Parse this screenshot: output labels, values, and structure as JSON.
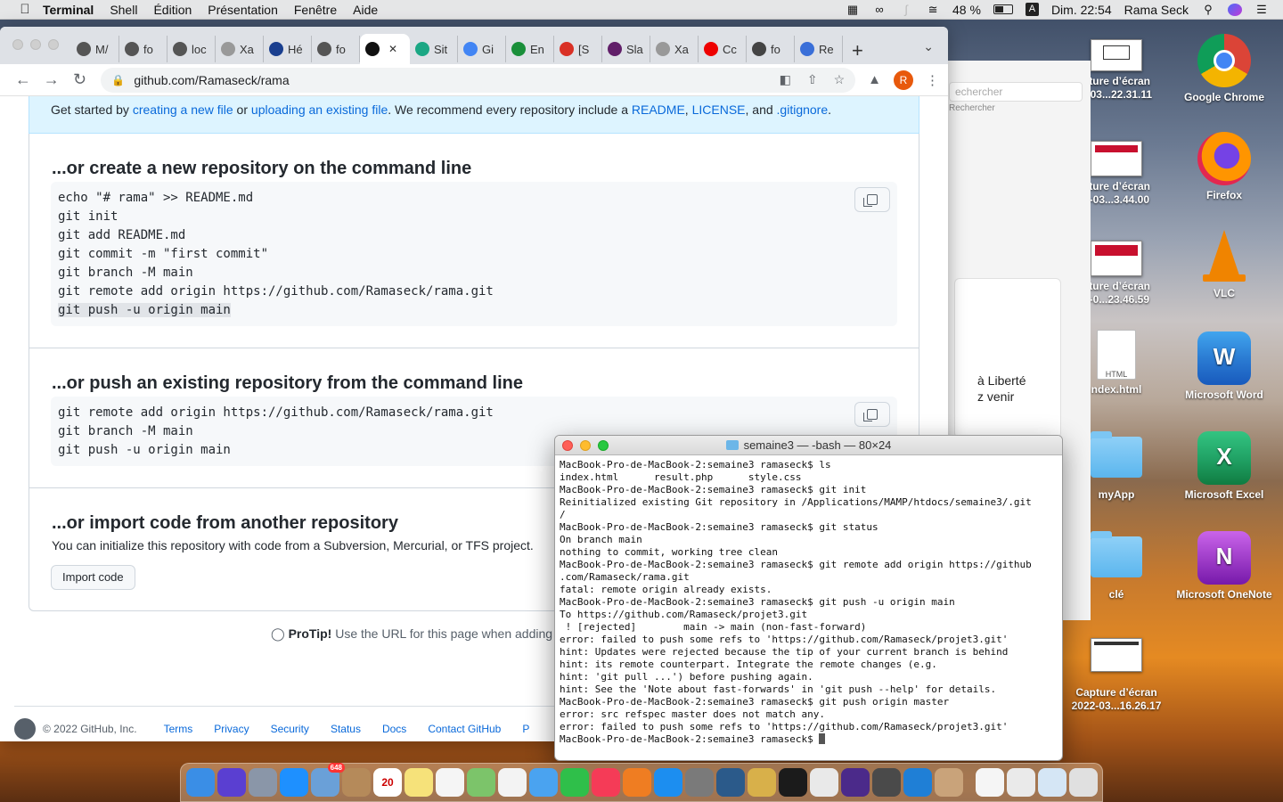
{
  "menubar": {
    "app": "Terminal",
    "items": [
      "Shell",
      "Édition",
      "Présentation",
      "Fenêtre",
      "Aide"
    ],
    "battery": "48 %",
    "input_source": "A",
    "clock": "Dim. 22:54",
    "user": "Rama Seck"
  },
  "desktop": {
    "icons": [
      {
        "label": "Google Chrome"
      },
      {
        "label": "Firefox"
      },
      {
        "label": "VLC"
      },
      {
        "label": "Microsoft Word"
      },
      {
        "label": "Microsoft Excel"
      },
      {
        "label": "Microsoft OneNote"
      },
      {
        "label": "pture d’écran\n2-03...22.31.11"
      },
      {
        "label": "pture d’écran\n2-03...3.44.00"
      },
      {
        "label": "pture d’écran\n2-0...23.46.59"
      },
      {
        "label": "ndex.html"
      },
      {
        "label": "myApp"
      },
      {
        "label": "clé"
      },
      {
        "label": "Capture d’écran\n2022-03...16.26.17"
      }
    ],
    "html_badge": "HTML"
  },
  "bg_window": {
    "search_placeholder": "echercher",
    "search_sub": "Rechercher",
    "text_line1": "à Liberté",
    "text_line2": "z venir"
  },
  "browser": {
    "tabs": [
      {
        "label": "M/",
        "color": "#555"
      },
      {
        "label": "fo",
        "color": "#555"
      },
      {
        "label": "loc",
        "color": "#555"
      },
      {
        "label": "Xa",
        "color": "#999"
      },
      {
        "label": "Hé",
        "color": "#1a3f8f"
      },
      {
        "label": "fo",
        "color": "#555"
      },
      {
        "label": "",
        "color": "#111",
        "active": true
      },
      {
        "label": "Sit",
        "color": "#1ba784"
      },
      {
        "label": "Gi",
        "color": "#4285f4"
      },
      {
        "label": "En",
        "color": "#1a8f3a"
      },
      {
        "label": "[S",
        "color": "#d93025"
      },
      {
        "label": "Sla",
        "color": "#611f69"
      },
      {
        "label": "Xa",
        "color": "#999"
      },
      {
        "label": "Cc",
        "color": "#e00"
      },
      {
        "label": "fo",
        "color": "#444"
      },
      {
        "label": "Re",
        "color": "#3a6fd8"
      }
    ],
    "url": "github.com/Ramaseck/rama",
    "profile_initial": "R"
  },
  "page": {
    "banner": {
      "t1": "Get started by ",
      "link1": "creating a new file",
      "t2": " or ",
      "link2": "uploading an existing file",
      "t3": ". We recommend every repository include a ",
      "link3": "README",
      "t4": ", ",
      "link4": "LICENSE",
      "t5": ", and ",
      "link5": ".gitignore",
      "t6": "."
    },
    "new_repo": {
      "title": "...or create a new repository on the command line",
      "lines": [
        "echo \"# rama\" >> README.md",
        "git init",
        "git add README.md",
        "git commit -m \"first commit\"",
        "git branch -M main",
        "git remote add origin https://github.com/Ramaseck/rama.git",
        "git push -u origin main"
      ]
    },
    "push_existing": {
      "title": "...or push an existing repository from the command line",
      "lines": [
        "git remote add origin https://github.com/Ramaseck/rama.git",
        "git branch -M main",
        "git push -u origin main"
      ]
    },
    "import": {
      "title": "...or import code from another repository",
      "desc": "You can initialize this repository with code from a Subversion, Mercurial, or TFS project.",
      "button": "Import code"
    },
    "protip": {
      "bold": "ProTip!",
      "text": " Use the URL for this page when adding"
    },
    "footer": {
      "copyright": "© 2022 GitHub, Inc.",
      "links": [
        "Terms",
        "Privacy",
        "Security",
        "Status",
        "Docs",
        "Contact GitHub",
        "P"
      ]
    }
  },
  "terminal": {
    "title": "semaine3 — -bash — 80×24",
    "lines": [
      "MacBook-Pro-de-MacBook-2:semaine3 ramaseck$ ls",
      "index.html      result.php      style.css",
      "MacBook-Pro-de-MacBook-2:semaine3 ramaseck$ git init",
      "Reinitialized existing Git repository in /Applications/MAMP/htdocs/semaine3/.git",
      "/",
      "MacBook-Pro-de-MacBook-2:semaine3 ramaseck$ git status",
      "On branch main",
      "nothing to commit, working tree clean",
      "MacBook-Pro-de-MacBook-2:semaine3 ramaseck$ git remote add origin https://github",
      ".com/Ramaseck/rama.git",
      "fatal: remote origin already exists.",
      "MacBook-Pro-de-MacBook-2:semaine3 ramaseck$ git push -u origin main",
      "To https://github.com/Ramaseck/projet3.git",
      " ! [rejected]        main -> main (non-fast-forward)",
      "error: failed to push some refs to 'https://github.com/Ramaseck/projet3.git'",
      "hint: Updates were rejected because the tip of your current branch is behind",
      "hint: its remote counterpart. Integrate the remote changes (e.g.",
      "hint: 'git pull ...') before pushing again.",
      "hint: See the 'Note about fast-forwards' in 'git push --help' for details.",
      "MacBook-Pro-de-MacBook-2:semaine3 ramaseck$ git push origin master",
      "error: src refspec master does not match any.",
      "error: failed to push some refs to 'https://github.com/Ramaseck/projet3.git'",
      "MacBook-Pro-de-MacBook-2:semaine3 ramaseck$ "
    ]
  },
  "dock": {
    "apps": [
      {
        "name": "finder",
        "color": "#3a8ee6"
      },
      {
        "name": "siri",
        "color": "#5a3fd1"
      },
      {
        "name": "launchpad",
        "color": "#8a96a8"
      },
      {
        "name": "safari",
        "color": "#1e90ff"
      },
      {
        "name": "mail-stamp",
        "color": "#6aa0d8",
        "badge": "648"
      },
      {
        "name": "contacts",
        "color": "#b58a5a"
      },
      {
        "name": "calendar",
        "color": "#ffffff",
        "text": "20"
      },
      {
        "name": "notes",
        "color": "#f6e27a"
      },
      {
        "name": "reminders",
        "color": "#f5f5f5"
      },
      {
        "name": "maps",
        "color": "#7cc46a"
      },
      {
        "name": "photos",
        "color": "#f3f3f3"
      },
      {
        "name": "messages-bubble",
        "color": "#4aa3f0"
      },
      {
        "name": "facetime",
        "color": "#2fbf4a"
      },
      {
        "name": "music",
        "color": "#f53b57"
      },
      {
        "name": "books",
        "color": "#ef7d22"
      },
      {
        "name": "app-store",
        "color": "#1c8ef0"
      },
      {
        "name": "system-preferences",
        "color": "#7a7a7a"
      },
      {
        "name": "mamp",
        "color": "#2b5a8a"
      },
      {
        "name": "sketch-pad",
        "color": "#d8b04a"
      },
      {
        "name": "terminal",
        "color": "#1b1b1b"
      },
      {
        "name": "chrome",
        "color": "#e9e9e9"
      },
      {
        "name": "imovie",
        "color": "#4b2a8a"
      },
      {
        "name": "mamp-pro",
        "color": "#4a4a4a"
      },
      {
        "name": "vscode",
        "color": "#1f7fd6"
      },
      {
        "name": "cinnamon-bot",
        "color": "#c9a37a"
      }
    ],
    "docs": [
      {
        "name": "html-file",
        "color": "#f5f5f5"
      },
      {
        "name": "preview-doc",
        "color": "#eaeaea"
      },
      {
        "name": "preview-app",
        "color": "#d5e6f5"
      },
      {
        "name": "trash",
        "color": "#e0e0e0"
      }
    ]
  }
}
